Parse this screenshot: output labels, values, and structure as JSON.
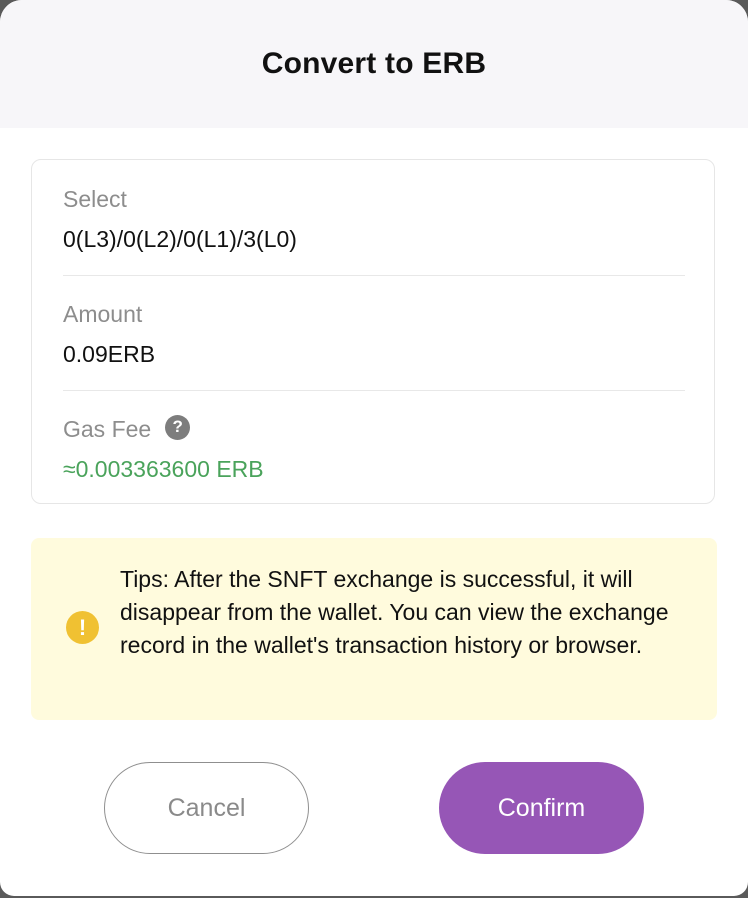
{
  "dialog": {
    "title": "Convert to ERB"
  },
  "details": {
    "select_label": "Select",
    "select_value": "0(L3)/0(L2)/0(L1)/3(L0)",
    "amount_label": "Amount",
    "amount_value": "0.09ERB",
    "gas_label": "Gas Fee",
    "gas_help_icon": "?",
    "gas_value": "≈0.003363600 ERB"
  },
  "tips": {
    "icon": "!",
    "text": "Tips: After the SNFT exchange is successful, it will disappear from the wallet. You can view the exchange record in the wallet's transaction history or browser."
  },
  "buttons": {
    "cancel_label": "Cancel",
    "confirm_label": "Confirm"
  },
  "colors": {
    "accent": "#9656b6",
    "gas_value": "#4aa35b",
    "tips_background": "#fffbdd",
    "warning_icon": "#f0c132"
  }
}
